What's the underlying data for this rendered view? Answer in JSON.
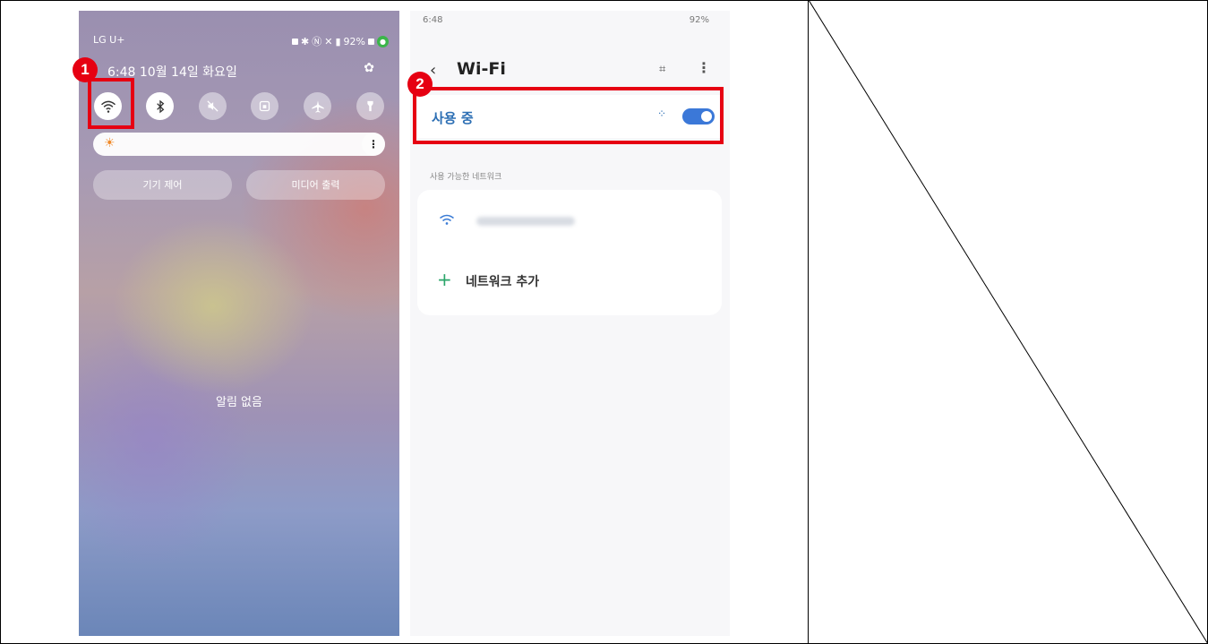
{
  "phone1": {
    "carrier": "LG U+",
    "status_right": "92%",
    "date": "6:48 10월 14일 화요일",
    "quick_settings": [
      {
        "name": "wifi",
        "icon": "wifi-icon",
        "active": true
      },
      {
        "name": "bluetooth",
        "icon": "bluetooth-icon",
        "active": true
      },
      {
        "name": "sound",
        "icon": "mute-icon",
        "active": false
      },
      {
        "name": "rotation-lock",
        "icon": "lock-icon",
        "active": false
      },
      {
        "name": "airplane",
        "icon": "airplane-icon",
        "active": false
      },
      {
        "name": "flashlight",
        "icon": "flashlight-icon",
        "active": false
      }
    ],
    "buttons": {
      "device_control": "기기 제어",
      "media_output": "미디어 출력"
    },
    "notification_text": "알림 없음"
  },
  "phone2": {
    "time": "6:48",
    "status_right": "92%",
    "title": "Wi-Fi",
    "in_use_label": "사용 중",
    "toggle_on": true,
    "available_label": "사용 가능한 네트워크",
    "add_network_label": "네트워크 추가"
  },
  "callouts": {
    "step1": "1",
    "step2": "2"
  },
  "colors": {
    "callout_red": "#e60012",
    "accent_blue": "#3b78d8",
    "add_green": "#2aa56a"
  }
}
